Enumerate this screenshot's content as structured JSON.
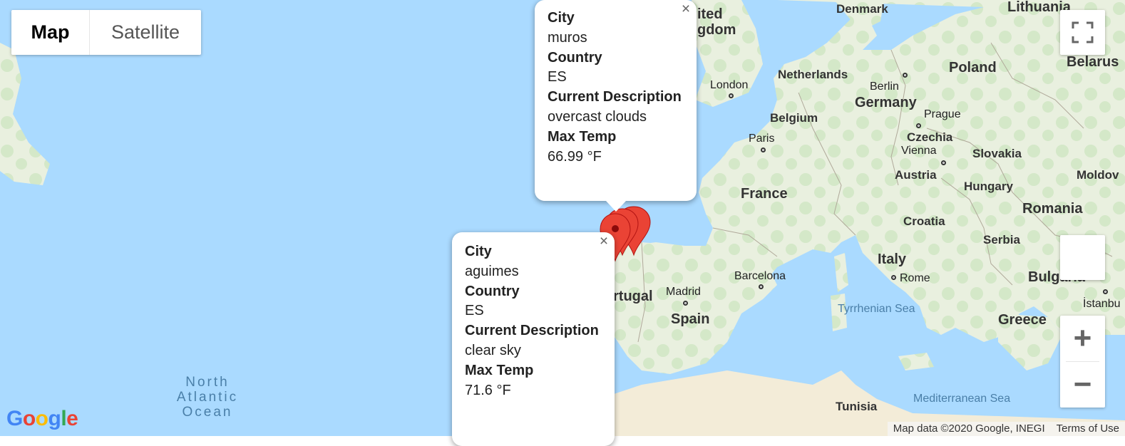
{
  "map_type_control": {
    "map": "Map",
    "satellite": "Satellite",
    "selected": "Map"
  },
  "countries": {
    "lithuania": "Lithuania",
    "denmark": "Denmark",
    "netherlands": "Netherlands",
    "poland": "Poland",
    "belarus": "Belarus",
    "germany": "Germany",
    "belgium": "Belgium",
    "czechia": "Czechia",
    "slovakia": "Slovakia",
    "austria": "Austria",
    "moldova": "Moldov",
    "hungary": "Hungary",
    "france": "France",
    "romania": "Romania",
    "croatia": "Croatia",
    "serbia": "Serbia",
    "italy": "Italy",
    "bulgaria": "Bulgaria",
    "portugal": "rtugal",
    "spain": "Spain",
    "greece": "Greece",
    "tunisia": "Tunisia",
    "united_kingdom_line1": "ited",
    "united_kingdom_line2": "gdom"
  },
  "cities": {
    "london": "London",
    "berlin": "Berlin",
    "prague": "Prague",
    "paris": "Paris",
    "vienna": "Vienna",
    "barcelona": "Barcelona",
    "madrid": "Madrid",
    "rome": "Rome",
    "istanbul": "İstanbu"
  },
  "seas": {
    "tyrrhenian": "Tyrrhenian Sea",
    "mediterranean": "Mediterranean Sea",
    "north_atlantic_line1": "North",
    "north_atlantic_line2": "Atlantic",
    "north_atlantic_line3": "Ocean"
  },
  "info_windows": [
    {
      "city_label": "City",
      "city": "muros",
      "country_label": "Country",
      "country": "ES",
      "desc_label": "Current Description",
      "desc": "overcast clouds",
      "temp_label": "Max Temp",
      "temp": "66.99 °F"
    },
    {
      "city_label": "City",
      "city": "aguimes",
      "country_label": "Country",
      "country": "ES",
      "desc_label": "Current Description",
      "desc": "clear sky",
      "temp_label": "Max Temp",
      "temp": "71.6 °F"
    }
  ],
  "close_glyph": "×",
  "zoom": {
    "in": "+",
    "out": "−"
  },
  "footer": {
    "data": "Map data ©2020 Google, INEGI",
    "terms": "Terms of Use"
  },
  "google_logo": "Google",
  "colors": {
    "water": "#aadaff",
    "land": "#e8f0df",
    "forest": "#cde5c2",
    "marker": "#ea4335",
    "marker_dark": "#a50e0e"
  }
}
